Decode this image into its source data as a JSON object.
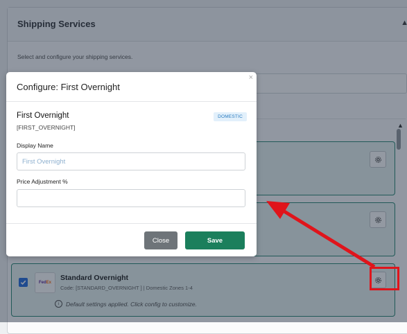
{
  "panel": {
    "title": "Shipping Services",
    "collapse_icon": "▲",
    "description": "Select and configure your shipping services."
  },
  "services": [
    {
      "name": "Standard Overnight",
      "code": "Code: [STANDARD_OVERNIGHT ] | Domestic Zones 1-4",
      "info": "Default settings applied. Click config to customize.",
      "logo_main": "Fed",
      "logo_accent": "Ex",
      "checked": true
    }
  ],
  "modal": {
    "title": "Configure: First Overnight",
    "close_icon": "×",
    "service_name": "First Overnight",
    "service_code": "[FIRST_OVERNIGHT]",
    "badge": "DOMESTIC",
    "display_name_label": "Display Name",
    "display_name_placeholder": "First Overnight",
    "display_name_value": "",
    "price_adjustment_label": "Price Adjustment %",
    "price_adjustment_value": "",
    "close_button": "Close",
    "save_button": "Save"
  },
  "colors": {
    "accent_green": "#1b7f5c",
    "checkbox_blue": "#1763d8",
    "annotation_red": "#e0141b",
    "badge_blue": "#2a7bbf"
  }
}
